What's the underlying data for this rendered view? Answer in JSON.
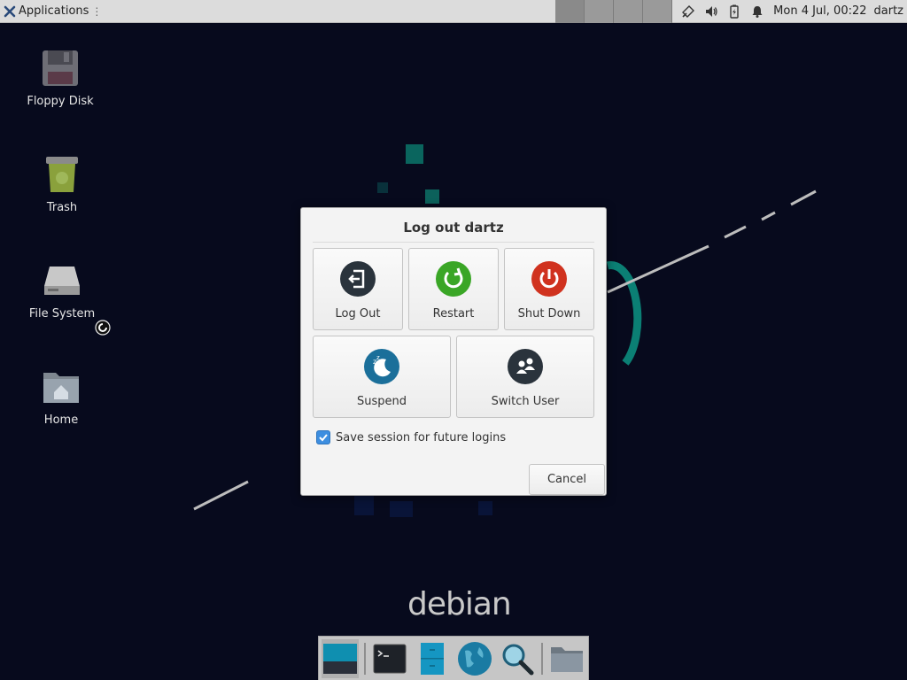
{
  "top_panel": {
    "applications_label": "Applications",
    "applications_handle": "⋮",
    "clock": "Mon  4 Jul, 00:22",
    "user": "dartz"
  },
  "desktop": {
    "icons": [
      {
        "label": "Floppy Disk",
        "icon": "floppy-disk-icon"
      },
      {
        "label": "Trash",
        "icon": "trash-icon"
      },
      {
        "label": "File System",
        "icon": "drive-icon"
      },
      {
        "label": "Home",
        "icon": "home-folder-icon"
      }
    ]
  },
  "wallpaper": {
    "brand": "debian",
    "colors": {
      "background": "#070a1d",
      "accent": "#0b7f74"
    }
  },
  "dialog": {
    "title": "Log out dartz",
    "actions": [
      {
        "label": "Log Out",
        "icon": "logout-icon",
        "color": "#2a333c"
      },
      {
        "label": "Restart",
        "icon": "restart-icon",
        "color": "#3aa626"
      },
      {
        "label": "Shut Down",
        "icon": "power-icon",
        "color": "#d0321f"
      },
      {
        "label": "Suspend",
        "icon": "suspend-icon",
        "color": "#1b6f9a"
      },
      {
        "label": "Switch User",
        "icon": "switch-user-icon",
        "color": "#2a333c"
      }
    ],
    "save_session": {
      "label": "Save session for future logins",
      "checked": true
    },
    "cancel_label": "Cancel"
  },
  "dock": {
    "items": [
      "show-desktop-icon",
      "terminal-icon",
      "file-manager-icon",
      "web-browser-icon",
      "app-finder-icon",
      "folder-icon"
    ]
  }
}
